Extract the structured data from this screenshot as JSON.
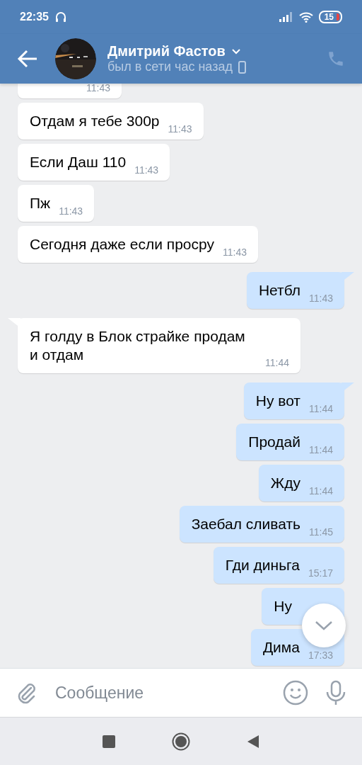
{
  "status_bar": {
    "time": "22:35",
    "battery": "15"
  },
  "header": {
    "name": "Дмитрий Фастов",
    "status": "был в сети час назад"
  },
  "messages": [
    {
      "time": "11:43",
      "outgoing": false,
      "tail": false
    },
    {
      "text": "Отдам я тебе 300р",
      "time": "11:43",
      "outgoing": false,
      "tail": false
    },
    {
      "text": "Если Даш 110",
      "time": "11:43",
      "outgoing": false,
      "tail": false
    },
    {
      "text": "Пж",
      "time": "11:43",
      "outgoing": false,
      "tail": false
    },
    {
      "text": "Сегодня даже если просру",
      "time": "11:43",
      "outgoing": false,
      "tail": false
    },
    {
      "text": "Нетбл",
      "time": "11:43",
      "outgoing": true,
      "tail": true
    },
    {
      "text": "Я голду в Блок страйке продам и отдам",
      "time": "11:44",
      "outgoing": false,
      "tail": true
    },
    {
      "text": "Ну вот",
      "time": "11:44",
      "outgoing": true,
      "tail": true
    },
    {
      "text": "Продай",
      "time": "11:44",
      "outgoing": true,
      "tail": false
    },
    {
      "text": "Жду",
      "time": "11:44",
      "outgoing": true,
      "tail": false
    },
    {
      "text": "Заебал сливать",
      "time": "11:45",
      "outgoing": true,
      "tail": false
    },
    {
      "text": "Гди диньга",
      "time": "15:17",
      "outgoing": true,
      "tail": false
    },
    {
      "text": "Ну",
      "outgoing": true,
      "tail": false
    },
    {
      "text": "Дима",
      "time": "17:33",
      "outgoing": true,
      "tail": false
    }
  ],
  "composer": {
    "placeholder": "Сообщение"
  }
}
